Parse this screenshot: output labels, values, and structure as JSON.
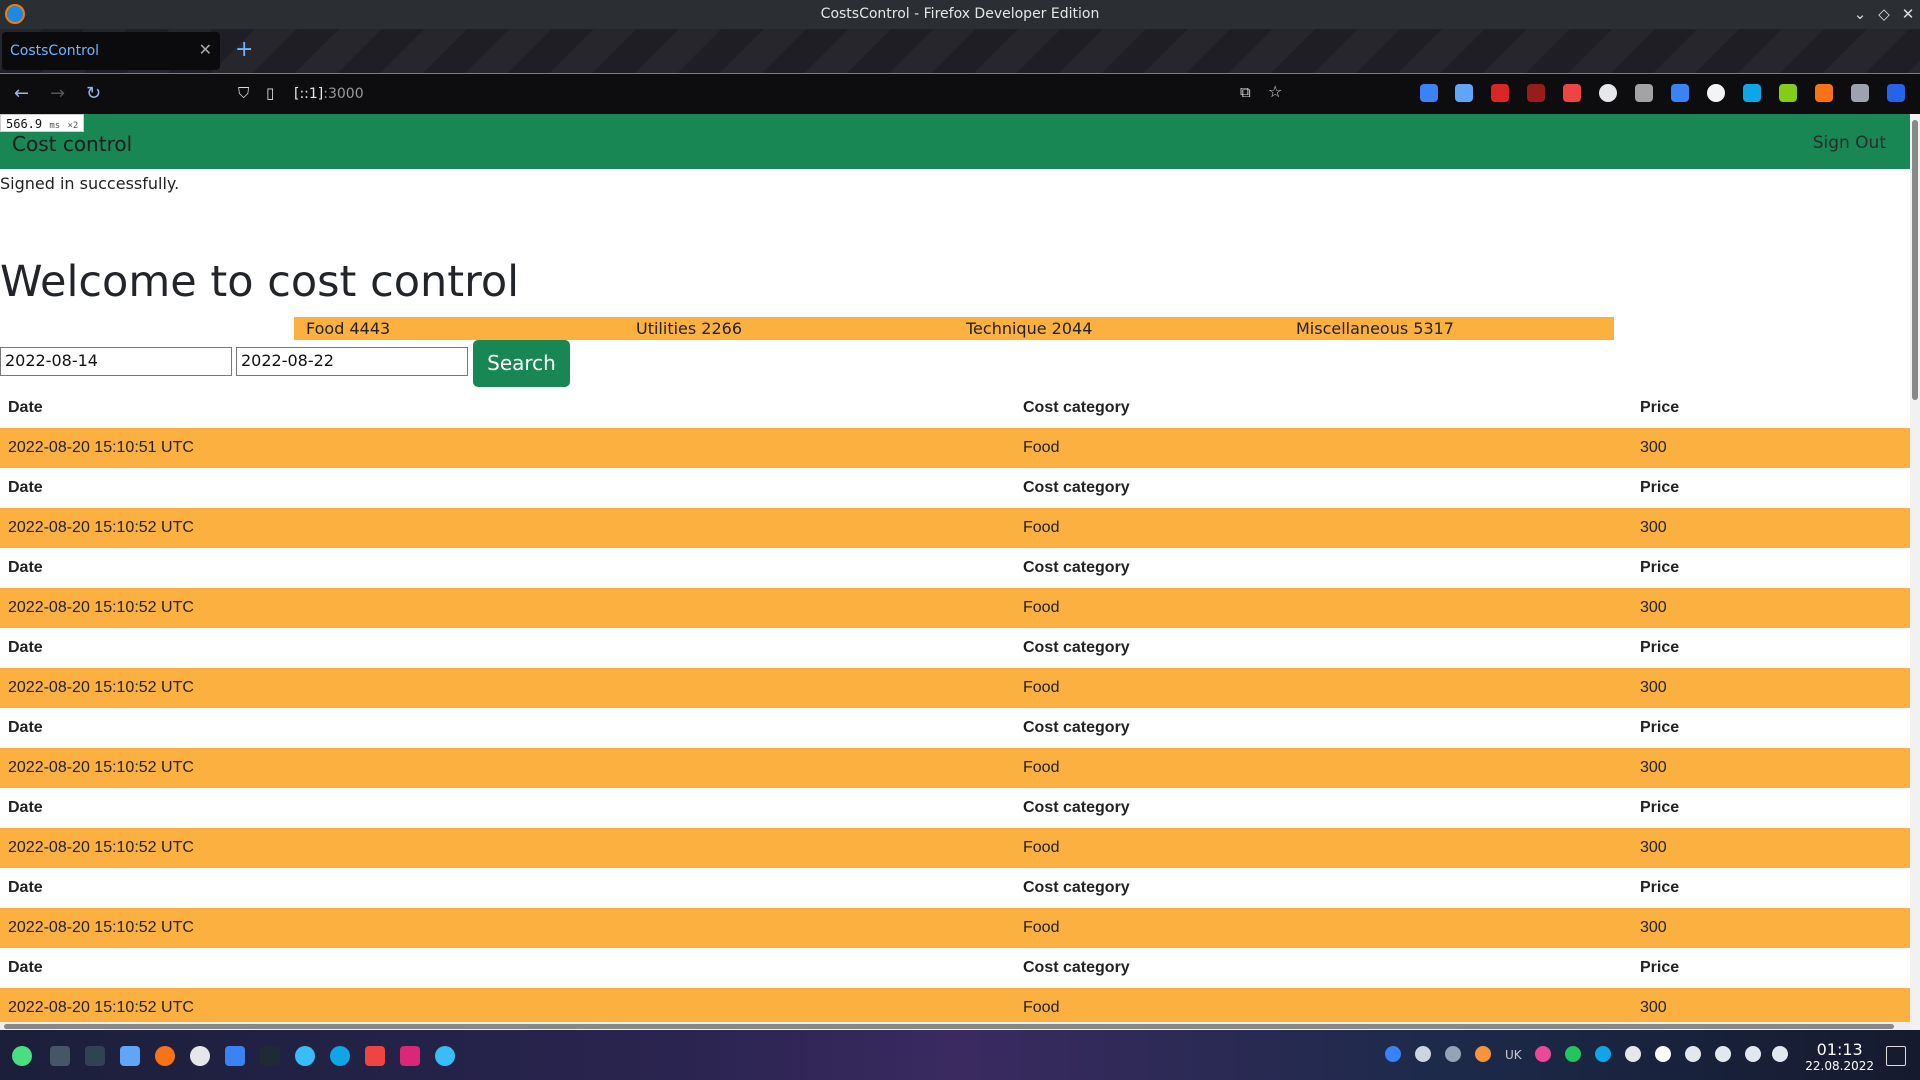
{
  "window": {
    "title": "CostsControl - Firefox Developer Edition"
  },
  "tab": {
    "label": "CostsControl"
  },
  "url": {
    "host": "[::1]",
    "port": ":3000"
  },
  "perf": {
    "ms": "566.9",
    "unit": "ms",
    "mult": "×2"
  },
  "app": {
    "brand": "Cost control",
    "signout": "Sign Out",
    "flash": "Signed in successfully.",
    "heading": "Welcome to cost control"
  },
  "summary": {
    "food": "Food 4443",
    "utilities": "Utilities 2266",
    "technique": "Technique 2044",
    "misc": "Miscellaneous 5317"
  },
  "filters": {
    "from": "2022-08-14",
    "to": "2022-08-22",
    "search_label": "Search"
  },
  "table": {
    "headers": {
      "date": "Date",
      "category": "Cost category",
      "price": "Price"
    },
    "rows": [
      {
        "date": "2022-08-20 15:10:51 UTC",
        "category": "Food",
        "price": "300"
      },
      {
        "date": "2022-08-20 15:10:52 UTC",
        "category": "Food",
        "price": "300"
      },
      {
        "date": "2022-08-20 15:10:52 UTC",
        "category": "Food",
        "price": "300"
      },
      {
        "date": "2022-08-20 15:10:52 UTC",
        "category": "Food",
        "price": "300"
      },
      {
        "date": "2022-08-20 15:10:52 UTC",
        "category": "Food",
        "price": "300"
      },
      {
        "date": "2022-08-20 15:10:52 UTC",
        "category": "Food",
        "price": "300"
      },
      {
        "date": "2022-08-20 15:10:52 UTC",
        "category": "Food",
        "price": "300"
      },
      {
        "date": "2022-08-20 15:10:52 UTC",
        "category": "Food",
        "price": "300"
      }
    ]
  },
  "taskbar": {
    "lang": "UK",
    "time": "01:13",
    "date": "22.08.2022"
  },
  "colors": {
    "green": "#198754",
    "orange": "#fbb040"
  }
}
